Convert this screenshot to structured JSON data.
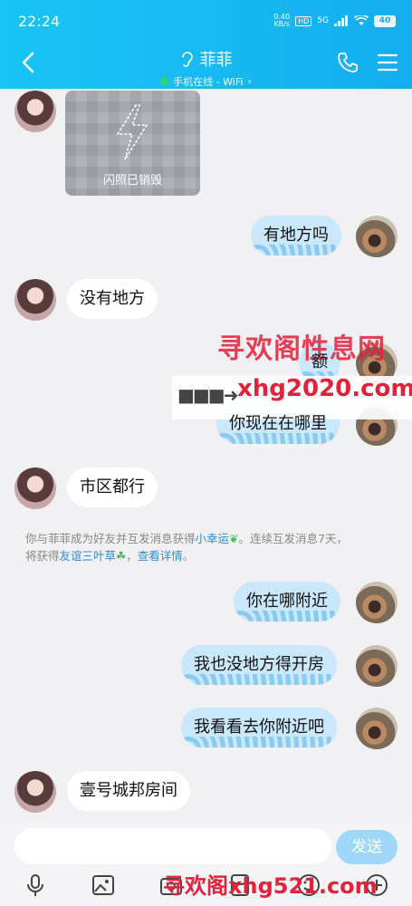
{
  "status_bar": {
    "time": "22:24",
    "net_speed_value": "0.40",
    "net_speed_unit": "KB/s",
    "hd": "HD",
    "signal": "5G",
    "battery": "40"
  },
  "header": {
    "contact_name": "菲菲",
    "status": "手机在线 - WiFi",
    "accent": "#17b9f2"
  },
  "messages": [
    {
      "side": "in",
      "type": "flash",
      "text": "闪照已销毁"
    },
    {
      "side": "out",
      "text": "有地方吗"
    },
    {
      "side": "in",
      "text": "没有地方"
    },
    {
      "side": "out",
      "text": "额"
    },
    {
      "side": "out",
      "text": "你现在在哪里"
    },
    {
      "side": "in",
      "text": "市区都行"
    },
    {
      "side": "out",
      "text": "你在哪附近"
    },
    {
      "side": "out",
      "text": "我也没地方得开房"
    },
    {
      "side": "out",
      "text": "我看看去你附近吧"
    },
    {
      "side": "in",
      "text": "壹号城邦房间"
    }
  ],
  "system_note": {
    "part1": "你与菲菲成为好友并互发消息获得",
    "link1": "小幸运",
    "part2": "。连续互发消息7天，",
    "part3": "将获得",
    "link2": "友谊三叶草",
    "part4": "，",
    "link3": "查看详情",
    "part5": "。"
  },
  "watermarks": {
    "top": "寻欢阁性息网",
    "arrow": "■■■➜",
    "domain": "xhg2020.com",
    "bottom": "寻欢阁xhg521.com"
  },
  "input": {
    "placeholder": "",
    "send_label": "发送"
  },
  "toolbar": {
    "icons": [
      "mic-icon",
      "image-icon",
      "camera-icon",
      "red-packet-icon",
      "emoji-icon",
      "plus-icon"
    ]
  }
}
